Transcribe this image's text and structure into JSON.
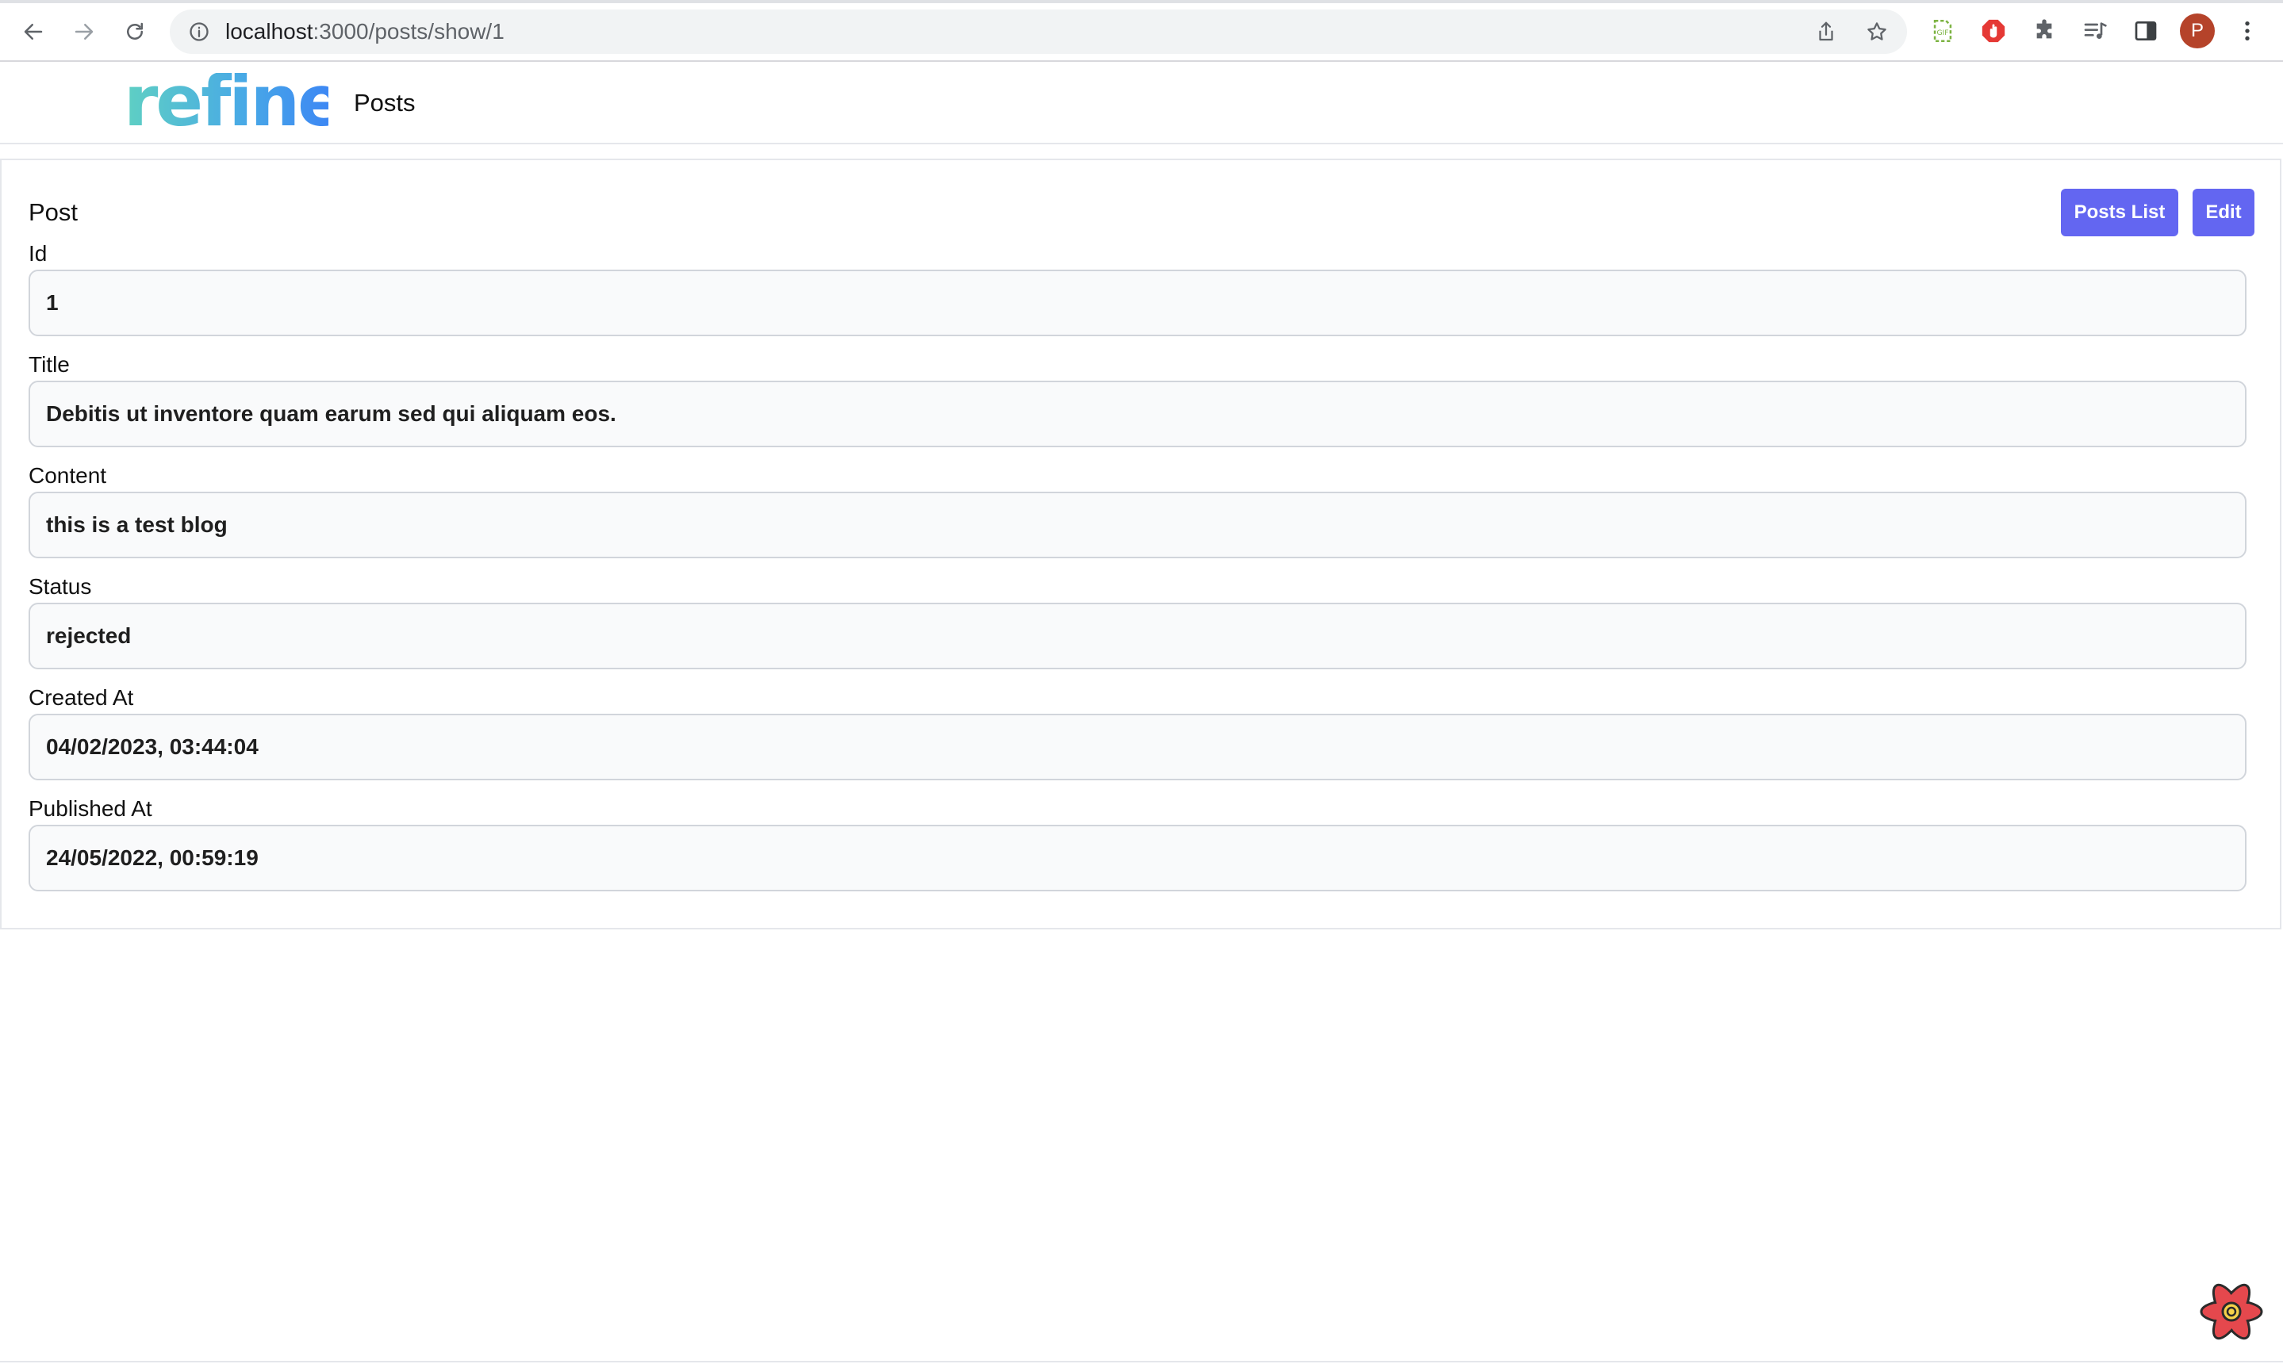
{
  "browser": {
    "url_host": "localhost",
    "url_rest": ":3000/posts/show/1",
    "avatar_letter": "P",
    "icons": [
      "back-icon",
      "forward-icon",
      "reload-icon",
      "info-icon",
      "share-icon",
      "star-icon",
      "gif-extension-icon",
      "adblock-extension-icon",
      "puzzle-extensions-icon",
      "media-queue-icon",
      "side-panel-icon",
      "more-vertical-icon"
    ]
  },
  "header": {
    "logo_text": "refine",
    "nav_item": "Posts"
  },
  "card": {
    "title": "Post",
    "buttons": {
      "list": "Posts List",
      "edit": "Edit"
    },
    "fields": [
      {
        "label": "Id",
        "value": "1"
      },
      {
        "label": "Title",
        "value": "Debitis ut inventore quam earum sed qui aliquam eos."
      },
      {
        "label": "Content",
        "value": "this is a test blog"
      },
      {
        "label": "Status",
        "value": "rejected"
      },
      {
        "label": "Created At",
        "value": "04/02/2023, 03:44:04"
      },
      {
        "label": "Published At",
        "value": "24/05/2022, 00:59:19"
      }
    ]
  },
  "colors": {
    "accent": "#6366f1",
    "logo_teal": "#5fd0c3",
    "logo_blue": "#3b82f6",
    "devtools_red": "#e5484d"
  }
}
